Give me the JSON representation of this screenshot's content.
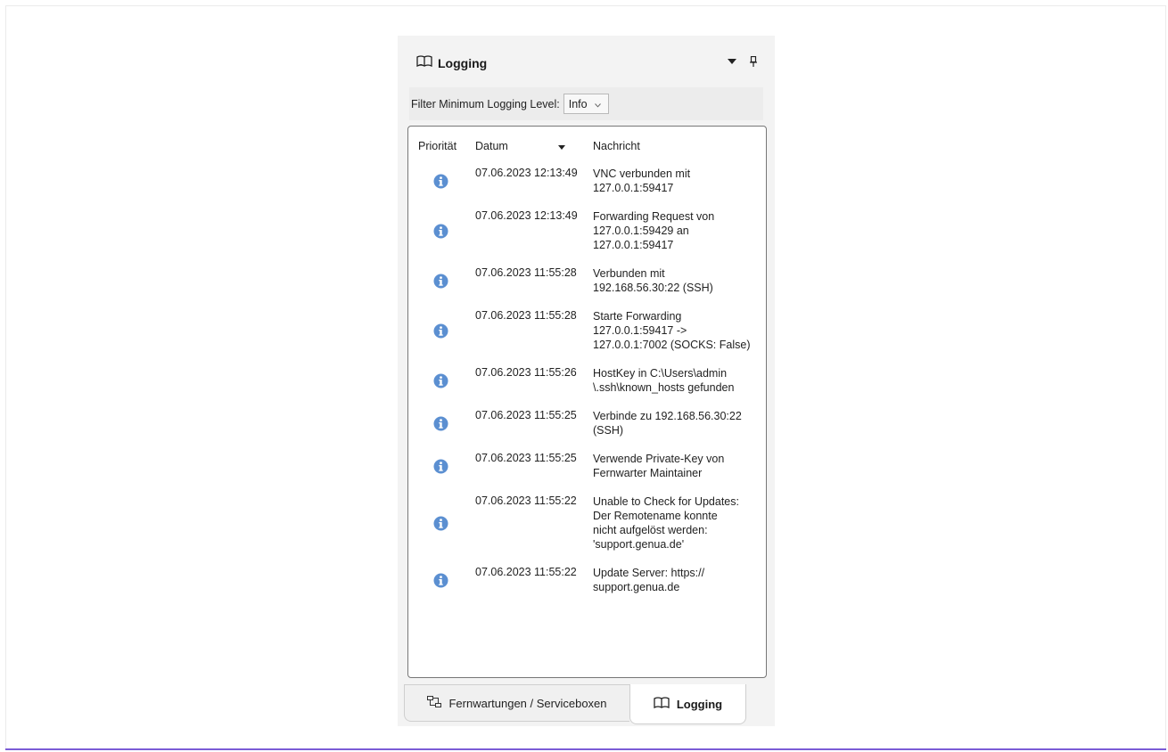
{
  "colors": {
    "accent_line": "#7b5cd6",
    "info_icon": "#5b8fd1",
    "panel_bg": "#f3f3f3"
  },
  "panel": {
    "title": "Logging",
    "title_icon": "open-book-icon",
    "dropdown_icon": "caret-down-icon",
    "pin_icon": "pin-icon"
  },
  "filter": {
    "label": "Filter Minimum Logging Level:",
    "value": "Info"
  },
  "log": {
    "columns": [
      "Priorität",
      "Datum",
      "Nachricht"
    ],
    "sort_column": "Datum",
    "rows": [
      {
        "priority": "info",
        "date": "07.06.2023 12:13:49",
        "message": "VNC verbunden mit\n127.0.0.1:59417"
      },
      {
        "priority": "info",
        "date": "07.06.2023 12:13:49",
        "message": "Forwarding Request von\n127.0.0.1:59429 an\n127.0.0.1:59417"
      },
      {
        "priority": "info",
        "date": "07.06.2023 11:55:28",
        "message": "Verbunden mit\n192.168.56.30:22 (SSH)"
      },
      {
        "priority": "info",
        "date": "07.06.2023 11:55:28",
        "message": "Starte Forwarding\n127.0.0.1:59417 ->\n127.0.0.1:7002 (SOCKS: False)"
      },
      {
        "priority": "info",
        "date": "07.06.2023 11:55:26",
        "message": "HostKey in C:\\Users\\admin\n\\.ssh\\known_hosts gefunden"
      },
      {
        "priority": "info",
        "date": "07.06.2023 11:55:25",
        "message": "Verbinde zu 192.168.56.30:22\n(SSH)"
      },
      {
        "priority": "info",
        "date": "07.06.2023 11:55:25",
        "message": "Verwende Private-Key von\nFernwarter Maintainer"
      },
      {
        "priority": "info",
        "date": "07.06.2023 11:55:22",
        "message": "Unable to Check for Updates:\nDer Remotename konnte\nnicht aufgelöst werden:\n'support.genua.de'"
      },
      {
        "priority": "info",
        "date": "07.06.2023 11:55:22",
        "message": "Update Server: https://\nsupport.genua.de"
      }
    ]
  },
  "tabs": [
    {
      "label": "Fernwartungen / Serviceboxen",
      "icon": "network-icon",
      "active": false
    },
    {
      "label": "Logging",
      "icon": "open-book-icon",
      "active": true
    }
  ]
}
